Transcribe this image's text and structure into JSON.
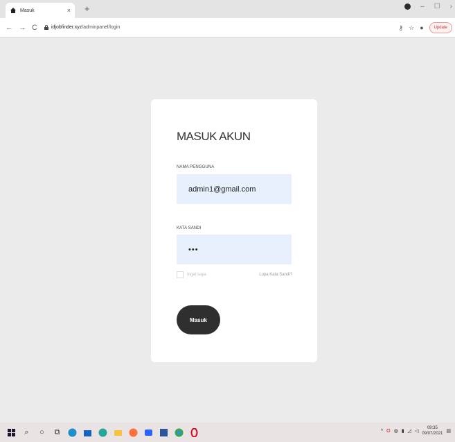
{
  "browser": {
    "tab_title": "Masuk",
    "tab_close": "×",
    "new_tab": "+",
    "url_domain": "idjobfinder.xyz",
    "url_path": "/adminpanel/login",
    "update_label": "Update"
  },
  "login": {
    "title": "MASUK AKUN",
    "username_label": "NAMA PENGGUNA",
    "username_value": "admin1@gmail.com",
    "password_label": "KATA SANDI",
    "password_value": "•••",
    "remember_label": "Ingat saya",
    "forgot_label": "Lupa Kata Sandi?",
    "submit_label": "Masuk"
  },
  "taskbar": {
    "time": "09:35",
    "date": "09/07/2021"
  },
  "colors": {
    "page_bg": "#ebebeb",
    "input_bg": "#e8effd",
    "button_bg": "#2f2f2f"
  }
}
